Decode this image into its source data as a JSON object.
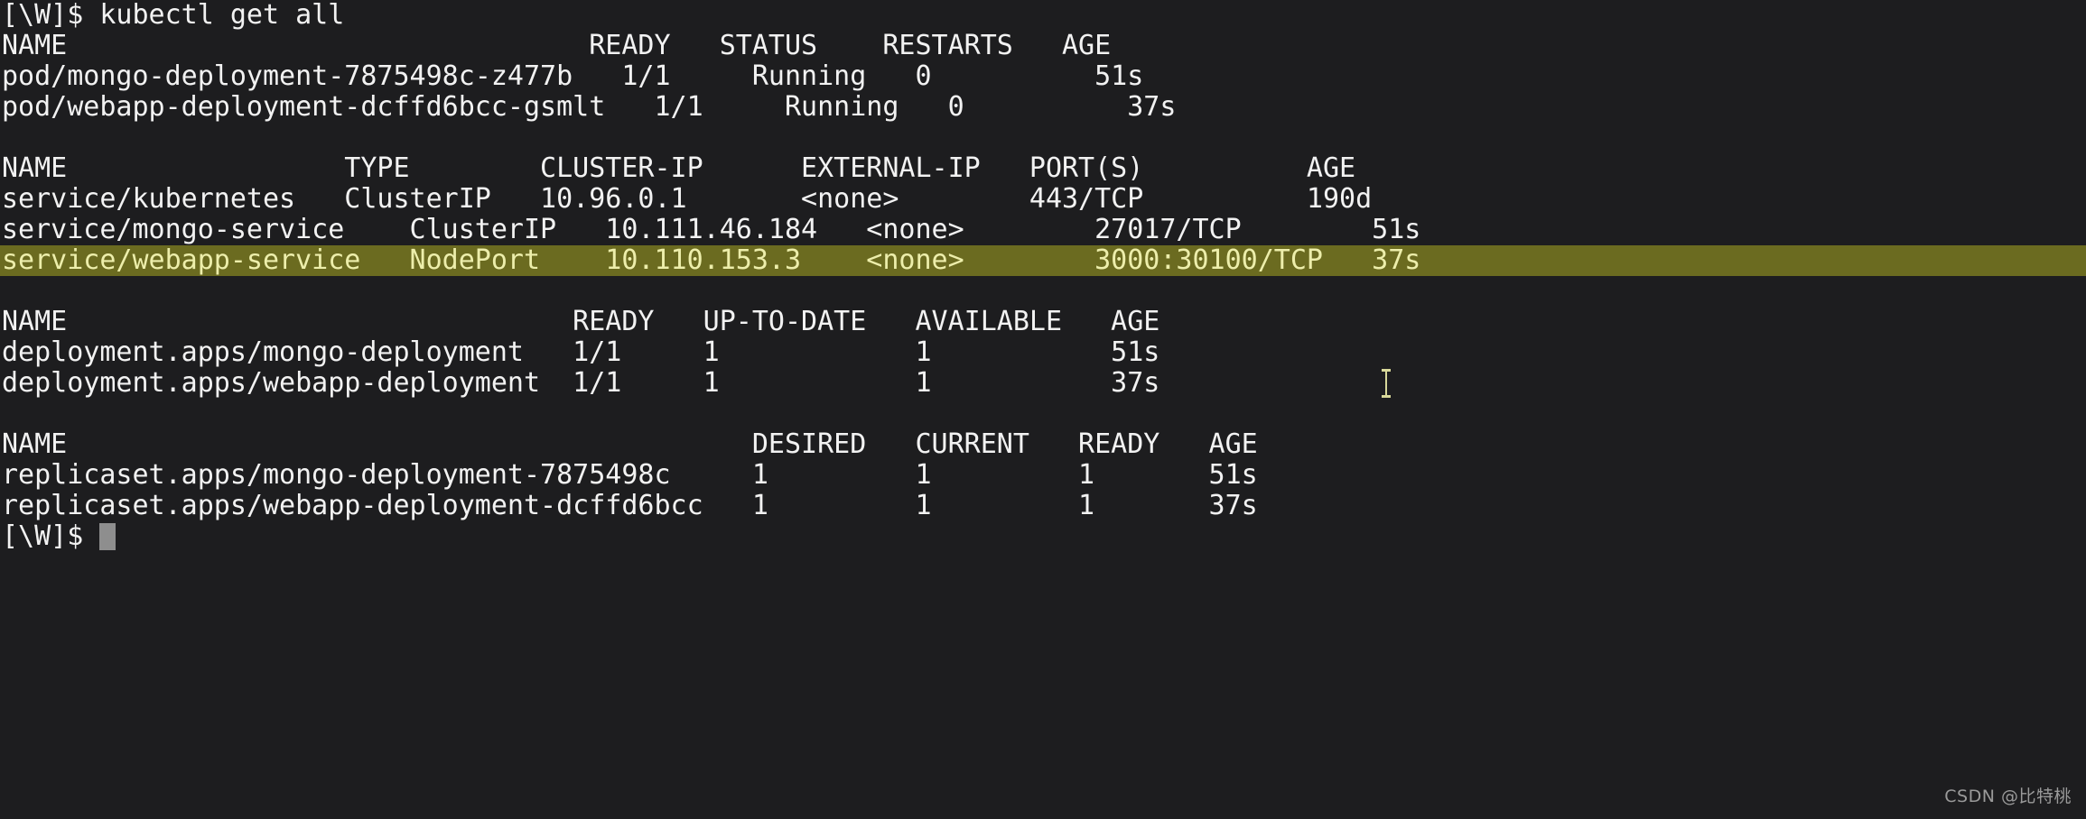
{
  "terminal": {
    "background_color": "#1d1d1f",
    "foreground_color": "#f2f2f2",
    "highlight_background_color": "#6b6b20",
    "highlight_foreground_color": "#edeeab",
    "cursor_color": "#8e8e8e",
    "prompt": "[\\W]$ ",
    "command": "kubectl get all",
    "command_line": "[\\W]$ kubectl get all",
    "final_prompt": "[\\W]$ "
  },
  "lines": [
    {
      "id": "command-line",
      "text": "[\\W]$ kubectl get all",
      "highlight": false
    },
    {
      "id": "pods-header",
      "text": "NAME                                READY   STATUS    RESTARTS   AGE",
      "highlight": false
    },
    {
      "id": "pod-mongo",
      "text": "pod/mongo-deployment-7875498c-z477b   1/1     Running   0          51s",
      "highlight": false
    },
    {
      "id": "pod-webapp",
      "text": "pod/webapp-deployment-dcffd6bcc-gsmlt   1/1     Running   0          37s",
      "highlight": false
    },
    {
      "id": "blank-1",
      "text": " ",
      "highlight": false
    },
    {
      "id": "services-header",
      "text": "NAME                 TYPE        CLUSTER-IP      EXTERNAL-IP   PORT(S)          AGE",
      "highlight": false
    },
    {
      "id": "service-kubernetes",
      "text": "service/kubernetes   ClusterIP   10.96.0.1       <none>        443/TCP          190d",
      "highlight": false
    },
    {
      "id": "service-mongo",
      "text": "service/mongo-service    ClusterIP   10.111.46.184   <none>        27017/TCP        51s",
      "highlight": false
    },
    {
      "id": "service-webapp",
      "text": "service/webapp-service   NodePort    10.110.153.3    <none>        3000:30100/TCP   37s",
      "highlight": true
    },
    {
      "id": "blank-2",
      "text": " ",
      "highlight": false
    },
    {
      "id": "deployments-header",
      "text": "NAME                               READY   UP-TO-DATE   AVAILABLE   AGE",
      "highlight": false
    },
    {
      "id": "deployment-mongo",
      "text": "deployment.apps/mongo-deployment   1/1     1            1           51s",
      "highlight": false
    },
    {
      "id": "deployment-webapp",
      "text": "deployment.apps/webapp-deployment  1/1     1            1           37s",
      "highlight": false
    },
    {
      "id": "blank-3",
      "text": " ",
      "highlight": false
    },
    {
      "id": "replicasets-header",
      "text": "NAME                                          DESIRED   CURRENT   READY   AGE",
      "highlight": false
    },
    {
      "id": "replicaset-mongo",
      "text": "replicaset.apps/mongo-deployment-7875498c     1         1         1       51s",
      "highlight": false
    },
    {
      "id": "replicaset-webapp",
      "text": "replicaset.apps/webapp-deployment-dcffd6bcc   1         1         1       37s",
      "highlight": false
    }
  ],
  "tables": {
    "pods": {
      "columns": [
        "NAME",
        "READY",
        "STATUS",
        "RESTARTS",
        "AGE"
      ],
      "rows": [
        [
          "pod/mongo-deployment-7875498c-z477b",
          "1/1",
          "Running",
          "0",
          "51s"
        ],
        [
          "pod/webapp-deployment-dcffd6bcc-gsmlt",
          "1/1",
          "Running",
          "0",
          "37s"
        ]
      ]
    },
    "services": {
      "columns": [
        "NAME",
        "TYPE",
        "CLUSTER-IP",
        "EXTERNAL-IP",
        "PORT(S)",
        "AGE"
      ],
      "rows": [
        [
          "service/kubernetes",
          "ClusterIP",
          "10.96.0.1",
          "<none>",
          "443/TCP",
          "190d"
        ],
        [
          "service/mongo-service",
          "ClusterIP",
          "10.111.46.184",
          "<none>",
          "27017/TCP",
          "51s"
        ],
        [
          "service/webapp-service",
          "NodePort",
          "10.110.153.3",
          "<none>",
          "3000:30100/TCP",
          "37s"
        ]
      ],
      "highlighted_row_index": 2
    },
    "deployments": {
      "columns": [
        "NAME",
        "READY",
        "UP-TO-DATE",
        "AVAILABLE",
        "AGE"
      ],
      "rows": [
        [
          "deployment.apps/mongo-deployment",
          "1/1",
          "1",
          "1",
          "51s"
        ],
        [
          "deployment.apps/webapp-deployment",
          "1/1",
          "1",
          "1",
          "37s"
        ]
      ]
    },
    "replicasets": {
      "columns": [
        "NAME",
        "DESIRED",
        "CURRENT",
        "READY",
        "AGE"
      ],
      "rows": [
        [
          "replicaset.apps/mongo-deployment-7875498c",
          "1",
          "1",
          "1",
          "51s"
        ],
        [
          "replicaset.apps/webapp-deployment-dcffd6bcc",
          "1",
          "1",
          "1",
          "37s"
        ]
      ]
    }
  },
  "watermark": {
    "text": "CSDN @比特桃"
  }
}
